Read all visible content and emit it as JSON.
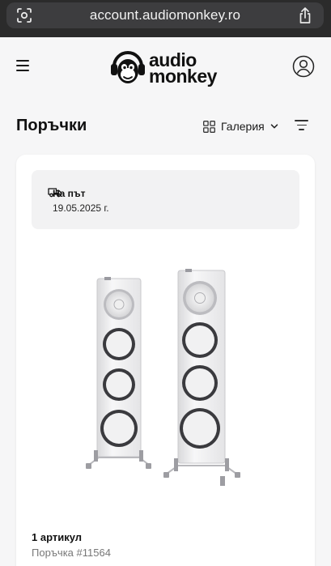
{
  "browser": {
    "url": "account.audiomonkey.ro",
    "icons": [
      "lens-icon",
      "share-icon"
    ]
  },
  "header": {
    "logo_line1": "audio",
    "logo_line2": "monkey",
    "icons": [
      "menu-icon",
      "account-icon"
    ]
  },
  "orders": {
    "title": "Поръчки",
    "view_label": "Галерия",
    "icons": [
      "grid-icon",
      "chevron-down-icon",
      "filter-icon"
    ]
  },
  "order": {
    "status": "На път",
    "date": "19.05.2025 г.",
    "item_count": "1 артикул",
    "number": "Поръчка #11564",
    "icons": [
      "truck-icon"
    ]
  },
  "colors": {
    "browser_bar": "#2b2b2b",
    "page_bg": "#f6f6f7",
    "card_bg": "#ffffff",
    "status_bg": "#f2f2f3",
    "muted_text": "#777777"
  }
}
